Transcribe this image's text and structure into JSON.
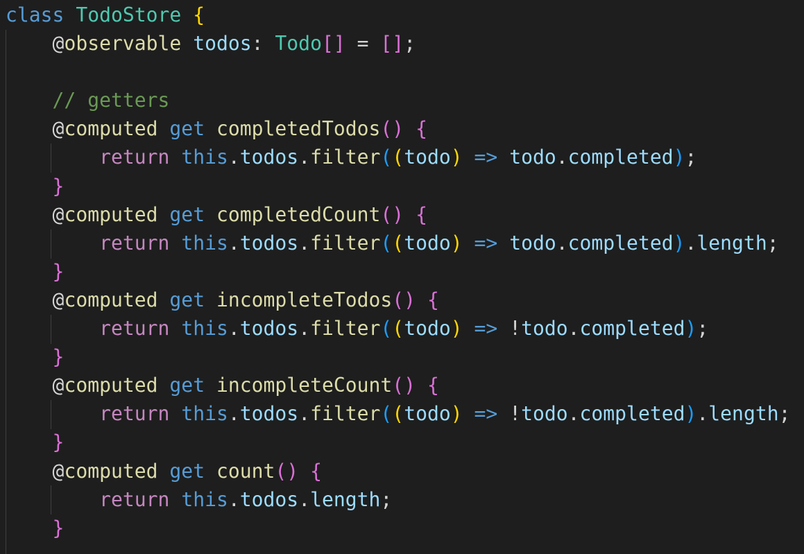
{
  "editor": {
    "theme": {
      "background": "#1e1e1e",
      "keyword": "#569cd6",
      "class_name": "#4ec9b0",
      "control": "#c586c0",
      "function": "#dcdcaa",
      "variable": "#9cdcfe",
      "punctuation": "#d4d4d4",
      "comment": "#6a9955",
      "bracket_level_1": "#ffd700",
      "bracket_level_2": "#da70d6",
      "bracket_level_3": "#179fff",
      "indent_guide": "#404040"
    },
    "lines": [
      [
        [
          "kw",
          "class"
        ],
        [
          "pun",
          " "
        ],
        [
          "cls",
          "TodoStore"
        ],
        [
          "pun",
          " "
        ],
        [
          "b1",
          "{"
        ]
      ],
      [
        [
          "pun",
          "    @"
        ],
        [
          "fn",
          "observable"
        ],
        [
          "pun",
          " "
        ],
        [
          "var",
          "todos"
        ],
        [
          "pun",
          ": "
        ],
        [
          "cls",
          "Todo"
        ],
        [
          "b2",
          "[]"
        ],
        [
          "pun",
          " = "
        ],
        [
          "b2",
          "[]"
        ],
        [
          "pun",
          ";"
        ]
      ],
      [],
      [
        [
          "pun",
          "    "
        ],
        [
          "cmt",
          "// getters"
        ]
      ],
      [
        [
          "pun",
          "    @"
        ],
        [
          "fn",
          "computed"
        ],
        [
          "pun",
          " "
        ],
        [
          "kw",
          "get"
        ],
        [
          "pun",
          " "
        ],
        [
          "fn",
          "completedTodos"
        ],
        [
          "b2",
          "()"
        ],
        [
          "pun",
          " "
        ],
        [
          "b2",
          "{"
        ]
      ],
      [
        [
          "pun",
          "        "
        ],
        [
          "ctl",
          "return"
        ],
        [
          "pun",
          " "
        ],
        [
          "kw",
          "this"
        ],
        [
          "pun",
          "."
        ],
        [
          "var",
          "todos"
        ],
        [
          "pun",
          "."
        ],
        [
          "fn",
          "filter"
        ],
        [
          "b3",
          "("
        ],
        [
          "b1",
          "("
        ],
        [
          "var",
          "todo"
        ],
        [
          "b1",
          ")"
        ],
        [
          "pun",
          " "
        ],
        [
          "kw",
          "=>"
        ],
        [
          "pun",
          " "
        ],
        [
          "var",
          "todo"
        ],
        [
          "pun",
          "."
        ],
        [
          "var",
          "completed"
        ],
        [
          "b3",
          ")"
        ],
        [
          "pun",
          ";"
        ]
      ],
      [
        [
          "pun",
          "    "
        ],
        [
          "b2",
          "}"
        ]
      ],
      [
        [
          "pun",
          "    @"
        ],
        [
          "fn",
          "computed"
        ],
        [
          "pun",
          " "
        ],
        [
          "kw",
          "get"
        ],
        [
          "pun",
          " "
        ],
        [
          "fn",
          "completedCount"
        ],
        [
          "b2",
          "()"
        ],
        [
          "pun",
          " "
        ],
        [
          "b2",
          "{"
        ]
      ],
      [
        [
          "pun",
          "        "
        ],
        [
          "ctl",
          "return"
        ],
        [
          "pun",
          " "
        ],
        [
          "kw",
          "this"
        ],
        [
          "pun",
          "."
        ],
        [
          "var",
          "todos"
        ],
        [
          "pun",
          "."
        ],
        [
          "fn",
          "filter"
        ],
        [
          "b3",
          "("
        ],
        [
          "b1",
          "("
        ],
        [
          "var",
          "todo"
        ],
        [
          "b1",
          ")"
        ],
        [
          "pun",
          " "
        ],
        [
          "kw",
          "=>"
        ],
        [
          "pun",
          " "
        ],
        [
          "var",
          "todo"
        ],
        [
          "pun",
          "."
        ],
        [
          "var",
          "completed"
        ],
        [
          "b3",
          ")"
        ],
        [
          "pun",
          "."
        ],
        [
          "var",
          "length"
        ],
        [
          "pun",
          ";"
        ]
      ],
      [
        [
          "pun",
          "    "
        ],
        [
          "b2",
          "}"
        ]
      ],
      [
        [
          "pun",
          "    @"
        ],
        [
          "fn",
          "computed"
        ],
        [
          "pun",
          " "
        ],
        [
          "kw",
          "get"
        ],
        [
          "pun",
          " "
        ],
        [
          "fn",
          "incompleteTodos"
        ],
        [
          "b2",
          "()"
        ],
        [
          "pun",
          " "
        ],
        [
          "b2",
          "{"
        ]
      ],
      [
        [
          "pun",
          "        "
        ],
        [
          "ctl",
          "return"
        ],
        [
          "pun",
          " "
        ],
        [
          "kw",
          "this"
        ],
        [
          "pun",
          "."
        ],
        [
          "var",
          "todos"
        ],
        [
          "pun",
          "."
        ],
        [
          "fn",
          "filter"
        ],
        [
          "b3",
          "("
        ],
        [
          "b1",
          "("
        ],
        [
          "var",
          "todo"
        ],
        [
          "b1",
          ")"
        ],
        [
          "pun",
          " "
        ],
        [
          "kw",
          "=>"
        ],
        [
          "pun",
          " !"
        ],
        [
          "var",
          "todo"
        ],
        [
          "pun",
          "."
        ],
        [
          "var",
          "completed"
        ],
        [
          "b3",
          ")"
        ],
        [
          "pun",
          ";"
        ]
      ],
      [
        [
          "pun",
          "    "
        ],
        [
          "b2",
          "}"
        ]
      ],
      [
        [
          "pun",
          "    @"
        ],
        [
          "fn",
          "computed"
        ],
        [
          "pun",
          " "
        ],
        [
          "kw",
          "get"
        ],
        [
          "pun",
          " "
        ],
        [
          "fn",
          "incompleteCount"
        ],
        [
          "b2",
          "()"
        ],
        [
          "pun",
          " "
        ],
        [
          "b2",
          "{"
        ]
      ],
      [
        [
          "pun",
          "        "
        ],
        [
          "ctl",
          "return"
        ],
        [
          "pun",
          " "
        ],
        [
          "kw",
          "this"
        ],
        [
          "pun",
          "."
        ],
        [
          "var",
          "todos"
        ],
        [
          "pun",
          "."
        ],
        [
          "fn",
          "filter"
        ],
        [
          "b3",
          "("
        ],
        [
          "b1",
          "("
        ],
        [
          "var",
          "todo"
        ],
        [
          "b1",
          ")"
        ],
        [
          "pun",
          " "
        ],
        [
          "kw",
          "=>"
        ],
        [
          "pun",
          " !"
        ],
        [
          "var",
          "todo"
        ],
        [
          "pun",
          "."
        ],
        [
          "var",
          "completed"
        ],
        [
          "b3",
          ")"
        ],
        [
          "pun",
          "."
        ],
        [
          "var",
          "length"
        ],
        [
          "pun",
          ";"
        ]
      ],
      [
        [
          "pun",
          "    "
        ],
        [
          "b2",
          "}"
        ]
      ],
      [
        [
          "pun",
          "    @"
        ],
        [
          "fn",
          "computed"
        ],
        [
          "pun",
          " "
        ],
        [
          "kw",
          "get"
        ],
        [
          "pun",
          " "
        ],
        [
          "fn",
          "count"
        ],
        [
          "b2",
          "()"
        ],
        [
          "pun",
          " "
        ],
        [
          "b2",
          "{"
        ]
      ],
      [
        [
          "pun",
          "        "
        ],
        [
          "ctl",
          "return"
        ],
        [
          "pun",
          " "
        ],
        [
          "kw",
          "this"
        ],
        [
          "pun",
          "."
        ],
        [
          "var",
          "todos"
        ],
        [
          "pun",
          "."
        ],
        [
          "var",
          "length"
        ],
        [
          "pun",
          ";"
        ]
      ],
      [
        [
          "pun",
          "    "
        ],
        [
          "b2",
          "}"
        ]
      ]
    ]
  }
}
